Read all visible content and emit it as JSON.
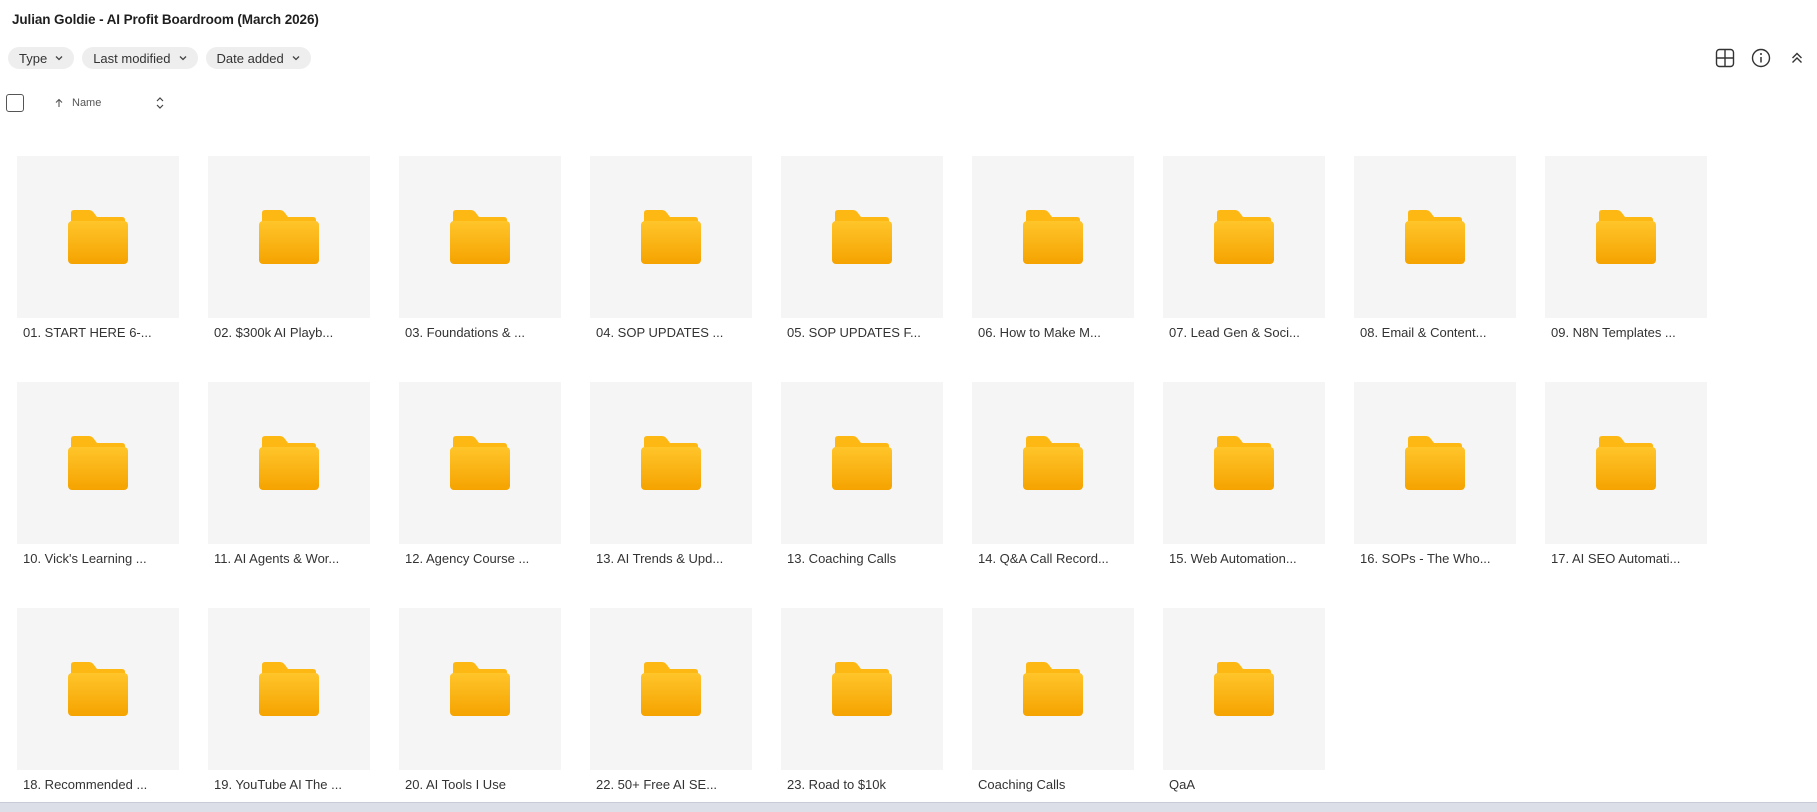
{
  "header": {
    "title": "Julian Goldie - AI Profit Boardroom (March 2026)"
  },
  "filters": [
    {
      "label": "Type"
    },
    {
      "label": "Last modified"
    },
    {
      "label": "Date added"
    }
  ],
  "toolbar": {
    "icons": [
      "grid-view-icon",
      "info-icon",
      "collapse-icon"
    ]
  },
  "sort": {
    "column_label": "Name",
    "direction": "ascending"
  },
  "colors": {
    "folder_top": "#FFC52A",
    "folder_bottom": "#F5A300",
    "tile_bg": "#F5F5F5",
    "chip_bg": "#EEEEEE"
  },
  "folders": [
    {
      "name": "01. START HERE 6-..."
    },
    {
      "name": "02. $300k AI Playb..."
    },
    {
      "name": "03. Foundations & ..."
    },
    {
      "name": "04. SOP UPDATES ..."
    },
    {
      "name": "05. SOP UPDATES F..."
    },
    {
      "name": "06. How to Make M..."
    },
    {
      "name": "07. Lead Gen & Soci..."
    },
    {
      "name": "08. Email & Content..."
    },
    {
      "name": "09. N8N Templates ..."
    },
    {
      "name": "10. Vick's Learning ..."
    },
    {
      "name": "11. AI Agents & Wor..."
    },
    {
      "name": "12. Agency Course ..."
    },
    {
      "name": "13. AI Trends & Upd..."
    },
    {
      "name": "13. Coaching Calls"
    },
    {
      "name": "14. Q&A Call Record..."
    },
    {
      "name": "15. Web Automation..."
    },
    {
      "name": "16. SOPs - The Who..."
    },
    {
      "name": "17. AI SEO Automati..."
    },
    {
      "name": "18. Recommended ..."
    },
    {
      "name": "19. YouTube AI The ..."
    },
    {
      "name": "20. AI Tools I Use"
    },
    {
      "name": "22. 50+ Free AI SE..."
    },
    {
      "name": "23. Road to $10k"
    },
    {
      "name": "Coaching Calls"
    },
    {
      "name": "QaA"
    }
  ]
}
